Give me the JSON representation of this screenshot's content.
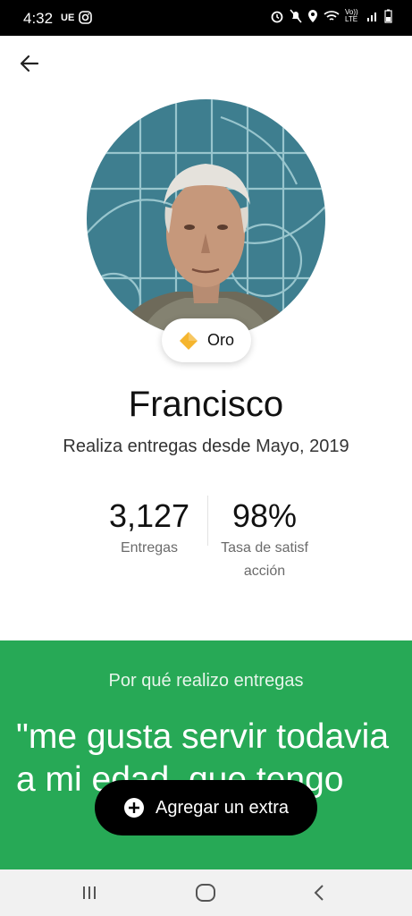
{
  "status_bar": {
    "time": "4:32",
    "carrier": "UE",
    "icons": [
      "instagram-icon",
      "alarm-icon",
      "mute-icon",
      "location-icon",
      "wifi-icon",
      "volte-icon",
      "signal-icon",
      "battery-icon"
    ],
    "volte_label": "Vo)) LTE"
  },
  "profile": {
    "badge_label": "Oro",
    "badge_color": "#f5b52e",
    "name": "Francisco",
    "subtitle": "Realiza entregas desde Mayo, 2019"
  },
  "stats": {
    "deliveries_value": "3,127",
    "deliveries_label": "Entregas",
    "satisfaction_value": "98%",
    "satisfaction_label": "Tasa de satisfacción"
  },
  "why_section": {
    "heading": "Por qué realizo entregas",
    "quote": "\"me gusta servir todavia a mi edad, que tengo",
    "background": "#27a956"
  },
  "extra_button": {
    "label": "Agregar un extra",
    "icon": "plus-circle-icon"
  },
  "nav_bar": {
    "icons": [
      "recents-icon",
      "home-icon",
      "back-icon"
    ]
  }
}
